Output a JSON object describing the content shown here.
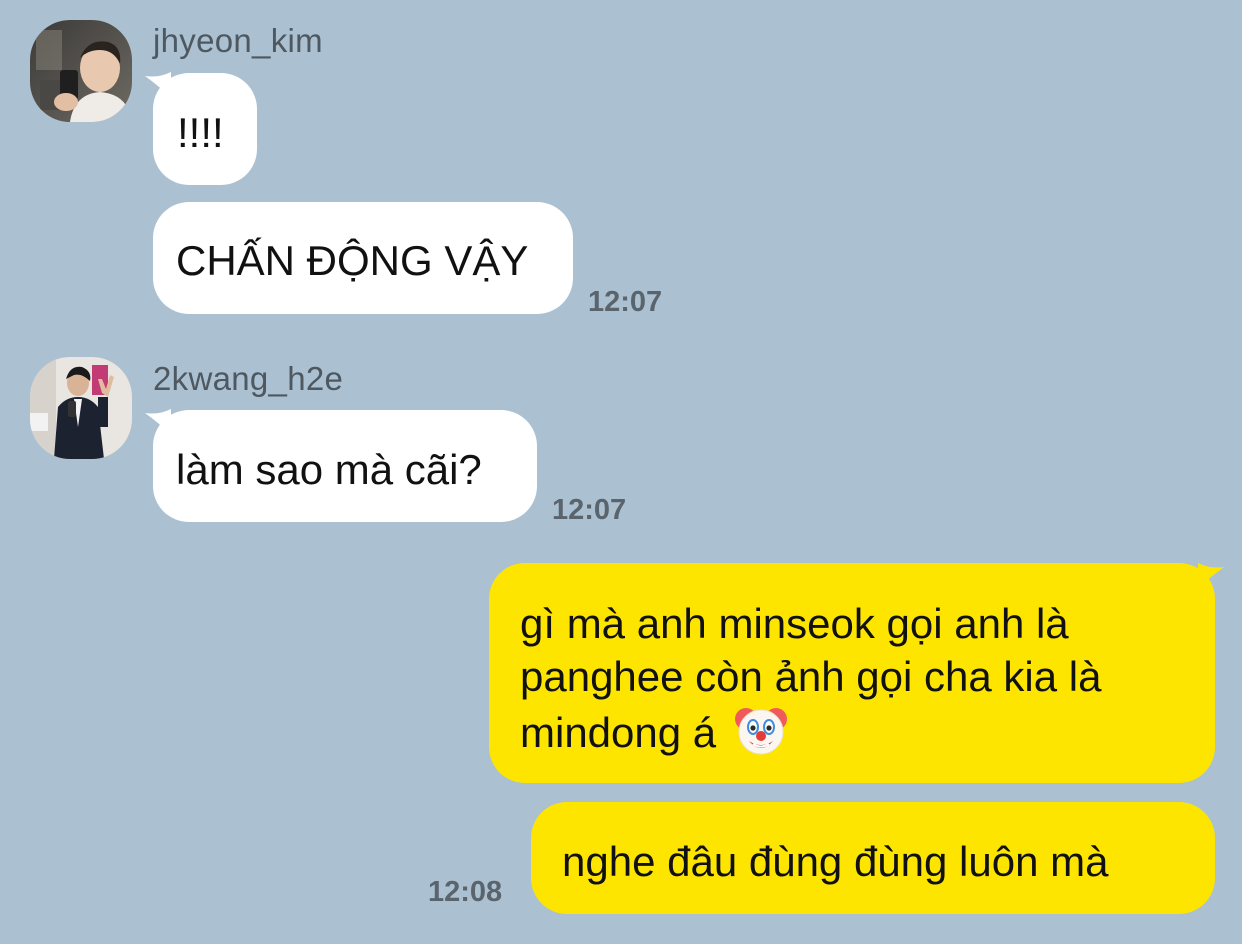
{
  "conversation": {
    "groups": [
      {
        "sender": "jhyeon_kim",
        "avatar_icon": "profile-photo-selfie",
        "messages": [
          {
            "text": "!!!!"
          },
          {
            "text": "CHẤN ĐỘNG VẬY"
          }
        ],
        "time": "12:07"
      },
      {
        "sender": "2kwang_h2e",
        "avatar_icon": "profile-photo-mirror-selfie",
        "messages": [
          {
            "text": "làm sao mà cãi?"
          }
        ],
        "time": "12:07"
      },
      {
        "sender": "me",
        "messages": [
          {
            "lines": [
              "gì mà anh minseok gọi anh là",
              "panghee còn ảnh gọi cha kia là",
              "mindong á"
            ],
            "emoji": "clown-face-emoji"
          },
          {
            "text": "nghe đâu đùng đùng luôn mà"
          }
        ],
        "time": "12:08"
      }
    ]
  },
  "colors": {
    "background": "#abc1d1",
    "incoming_bubble": "#ffffff",
    "outgoing_bubble": "#fee500",
    "text": "#111111",
    "meta_text": "#5a646d"
  }
}
